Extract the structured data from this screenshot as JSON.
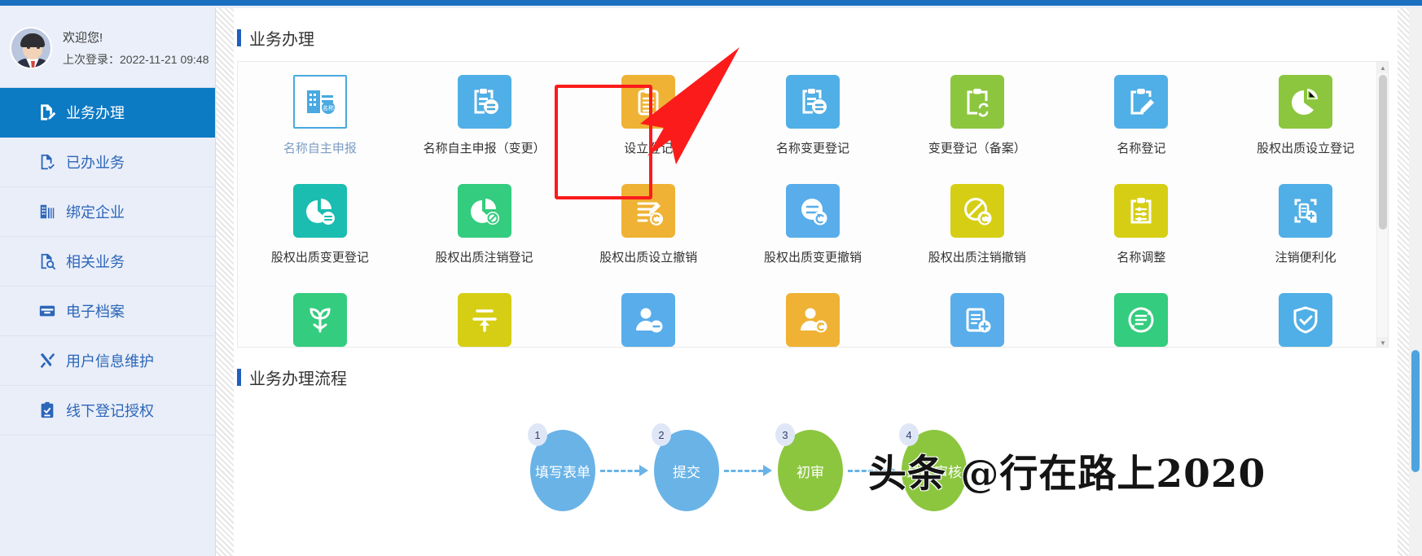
{
  "sidebar": {
    "welcome": {
      "greeting": "欢迎您!",
      "last_login": "上次登录：2022-11-21 09:48"
    },
    "items": [
      {
        "label": "业务办理",
        "icon": "document-edit-icon",
        "active": true
      },
      {
        "label": "已办业务",
        "icon": "document-check-icon",
        "active": false
      },
      {
        "label": "绑定企业",
        "icon": "building-icon",
        "active": false
      },
      {
        "label": "相关业务",
        "icon": "document-search-icon",
        "active": false
      },
      {
        "label": "电子档案",
        "icon": "archive-box-icon",
        "active": false
      },
      {
        "label": "用户信息维护",
        "icon": "wrench-screwdriver-icon",
        "active": false
      },
      {
        "label": "线下登记授权",
        "icon": "clipboard-check-icon",
        "active": false
      }
    ]
  },
  "main": {
    "section_title": "业务办理",
    "flow_title": "业务办理流程",
    "services": [
      {
        "label": "名称自主申报",
        "icon": "building-name-icon",
        "color": "#FFFFFF",
        "style": "outline",
        "muted": true
      },
      {
        "label": "名称自主申报（变更）",
        "icon": "clipboard-swap-icon",
        "color": "#50AFE6",
        "style": "solid",
        "muted": false
      },
      {
        "label": "设立登记",
        "icon": "clipboard-lines-icon",
        "color": "#EFB234",
        "style": "solid",
        "muted": false,
        "highlighted": true
      },
      {
        "label": "名称变更登记",
        "icon": "clipboard-swap-icon",
        "color": "#50AFE6",
        "style": "solid",
        "muted": false
      },
      {
        "label": "变更登记（备案）",
        "icon": "clipboard-refresh-icon",
        "color": "#8CC63F",
        "style": "solid",
        "muted": false
      },
      {
        "label": "名称登记",
        "icon": "clipboard-pencil-icon",
        "color": "#50AFE6",
        "style": "solid",
        "muted": false
      },
      {
        "label": "股权出质设立登记",
        "icon": "pie-chart-icon",
        "color": "#8CC63F",
        "style": "solid",
        "muted": false
      },
      {
        "label": "股权出质变更登记",
        "icon": "pie-swap-icon",
        "color": "#1ABDB0",
        "style": "solid",
        "muted": false
      },
      {
        "label": "股权出质注销登记",
        "icon": "pie-ban-icon",
        "color": "#34CC7E",
        "style": "solid",
        "muted": false
      },
      {
        "label": "股权出质设立撤销",
        "icon": "lines-undo-icon",
        "color": "#EFB234",
        "style": "solid",
        "muted": false
      },
      {
        "label": "股权出质变更撤销",
        "icon": "swap-undo-icon",
        "color": "#58ADEA",
        "style": "solid",
        "muted": false
      },
      {
        "label": "股权出质注销撤销",
        "icon": "ban-undo-icon",
        "color": "#D6CE14",
        "style": "solid",
        "muted": false
      },
      {
        "label": "名称调整",
        "icon": "clipboard-settings-icon",
        "color": "#D6CE14",
        "style": "solid",
        "muted": false
      },
      {
        "label": "注销便利化",
        "icon": "doc-plus-frame-icon",
        "color": "#50AFE6",
        "style": "solid",
        "muted": false
      },
      {
        "label": "",
        "icon": "sprout-icon",
        "color": "#34CC7E",
        "style": "solid",
        "muted": false
      },
      {
        "label": "",
        "icon": "divide-up-icon",
        "color": "#D6CE14",
        "style": "solid",
        "muted": false
      },
      {
        "label": "",
        "icon": "person-minus-icon",
        "color": "#58ADEA",
        "style": "solid",
        "muted": false
      },
      {
        "label": "",
        "icon": "person-refresh-icon",
        "color": "#EFB234",
        "style": "solid",
        "muted": false
      },
      {
        "label": "",
        "icon": "doc-plus-icon",
        "color": "#58ADEA",
        "style": "solid",
        "muted": false
      },
      {
        "label": "",
        "icon": "list-refresh-icon",
        "color": "#34CC7E",
        "style": "solid",
        "muted": false
      },
      {
        "label": "",
        "icon": "shield-check-icon",
        "color": "#50AFE6",
        "style": "solid",
        "muted": false
      }
    ],
    "flow_steps": [
      {
        "number": "1",
        "label": "填写表单",
        "color": "blue"
      },
      {
        "number": "2",
        "label": "提交",
        "color": "blue"
      },
      {
        "number": "3",
        "label": "初审",
        "color": "green"
      },
      {
        "number": "4",
        "label": "最终审核",
        "color": "green"
      }
    ]
  },
  "annotation": {
    "target_label": "设立登记",
    "box_color": "#FB1B1B"
  },
  "watermark": {
    "text": "头条 @行在路上2020"
  },
  "colors": {
    "accent": "#0D7AC4",
    "sidebar_bg": "#E9EEF9",
    "title_bar": "#1F5FC0"
  }
}
